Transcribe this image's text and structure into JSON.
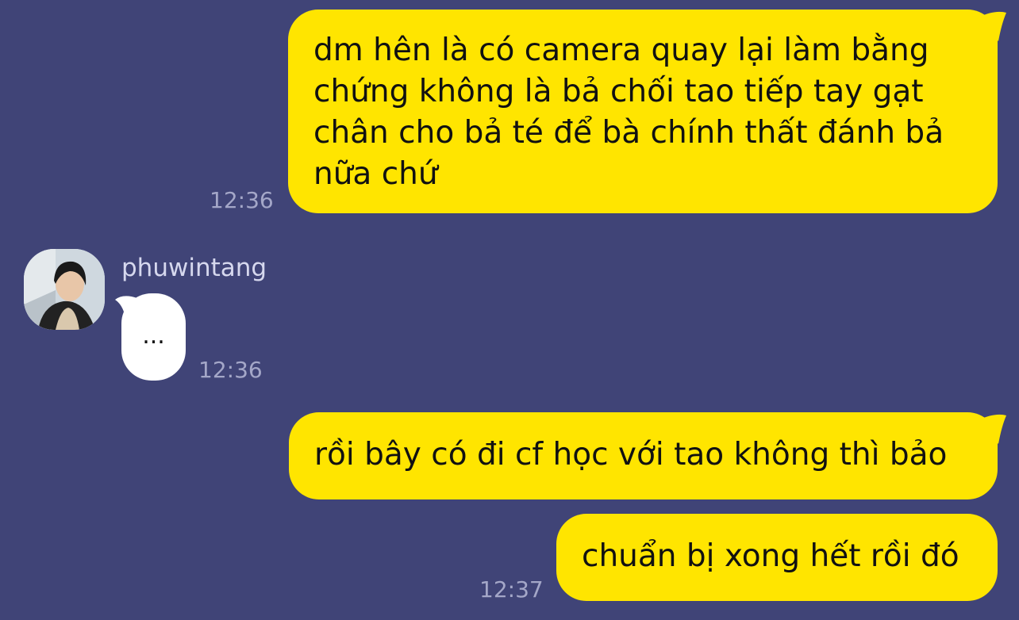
{
  "chat": {
    "messages": [
      {
        "sender": "me",
        "text": "dm hên là có camera quay lại làm bằng\nchứng không là bả chối tao tiếp tay gạt\nchân cho bả té để bà chính thất đánh bả\nnữa chứ",
        "time": "12:36"
      },
      {
        "sender": "phuwintang",
        "text": "...",
        "time": "12:36"
      },
      {
        "sender": "me",
        "text": "rồi bây có đi cf học với tao không thì bảo",
        "time": ""
      },
      {
        "sender": "me",
        "text": "chuẩn bị xong hết rồi đó",
        "time": "12:37"
      }
    ]
  },
  "contact": {
    "name": "phuwintang",
    "avatar_icon": "profile-photo"
  },
  "colors": {
    "background": "#404477",
    "outgoing_bubble": "#ffe500",
    "incoming_bubble": "#ffffff",
    "timestamp": "#a4a7c8"
  }
}
